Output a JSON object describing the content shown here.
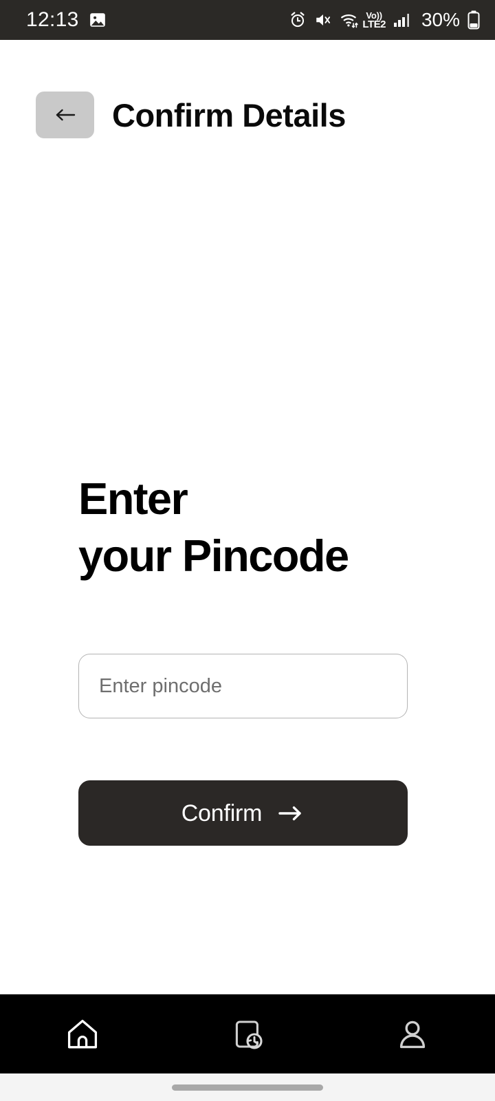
{
  "status_bar": {
    "time": "12:13",
    "battery_percent": "30%",
    "volte_label_top": "Vo))",
    "volte_label_bottom": "LTE2",
    "icons": [
      "image-notification-icon",
      "alarm-icon",
      "mute-icon",
      "wifi-icon",
      "volte-icon",
      "signal-icon",
      "battery-icon"
    ],
    "background_color": "#2b2926"
  },
  "header": {
    "back_label": "←",
    "title": "Confirm Details",
    "back_button_color": "#c9c9c9"
  },
  "main": {
    "headline_line1": "Enter",
    "headline_line2": "your Pincode",
    "pincode_placeholder": "Enter pincode",
    "pincode_value": "",
    "confirm_label": "Confirm",
    "confirm_arrow": "→",
    "confirm_button_color": "#2b2826",
    "input_border_color": "#b3b3b3"
  },
  "bottom_nav": {
    "background_color": "#000000",
    "items": [
      {
        "name": "home",
        "icon": "home-icon"
      },
      {
        "name": "history",
        "icon": "document-clock-icon"
      },
      {
        "name": "profile",
        "icon": "person-icon"
      }
    ]
  }
}
